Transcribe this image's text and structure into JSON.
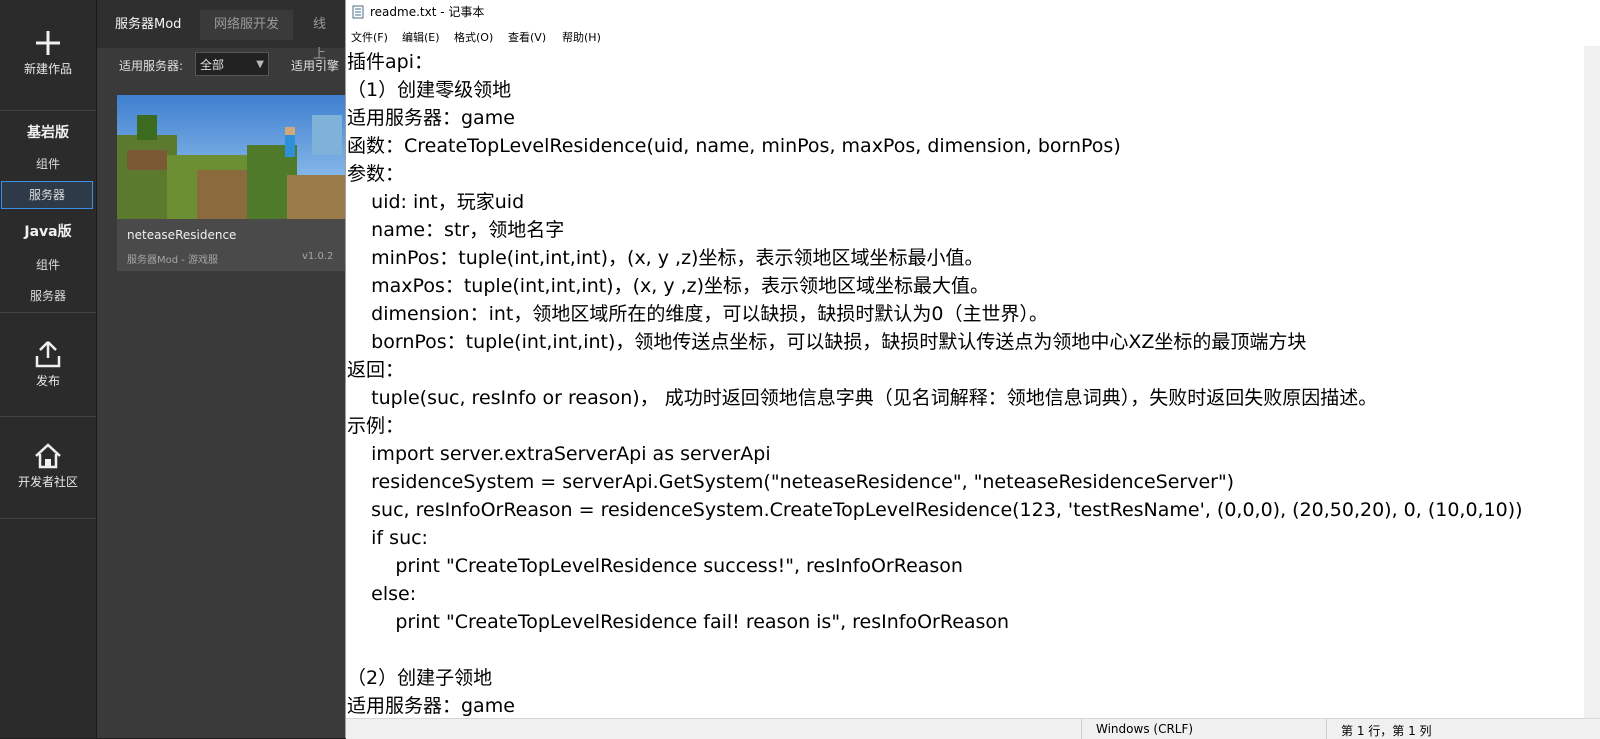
{
  "rail": {
    "new_work": "新建作品",
    "bedrock": "基岩版",
    "bedrock_component": "组件",
    "bedrock_server": "服务器",
    "java": "Java版",
    "java_component": "组件",
    "java_server": "服务器",
    "publish": "发布",
    "community": "开发者社区"
  },
  "tabs": [
    "服务器Mod",
    "网络服开发",
    "线上"
  ],
  "filter": {
    "server_label": "适用服务器:",
    "server_value": "全部",
    "engine_label": "适用引擎"
  },
  "card": {
    "title": "neteaseResidence",
    "meta": "服务器Mod - 游戏服",
    "version": "v1.0.2"
  },
  "notepad": {
    "title": "readme.txt - 记事本",
    "menu": [
      "文件(F)",
      "编辑(E)",
      "格式(O)",
      "查看(V)",
      "帮助(H)"
    ],
    "lines": [
      "插件api：",
      "（1）创建零级领地",
      "适用服务器：game",
      "函数：CreateTopLevelResidence(uid, name, minPos, maxPos, dimension, bornPos)",
      "参数：",
      "    uid: int，玩家uid",
      "    name：str，领地名字",
      "    minPos：tuple(int,int,int)，(x, y ,z)坐标，表示领地区域坐标最小值。",
      "    maxPos：tuple(int,int,int)，(x, y ,z)坐标，表示领地区域坐标最大值。",
      "    dimension：int，领地区域所在的维度，可以缺损，缺损时默认为0（主世界）。",
      "    bornPos：tuple(int,int,int)，领地传送点坐标，可以缺损，缺损时默认传送点为领地中心XZ坐标的最顶端方块",
      "返回：",
      "    tuple(suc, resInfo or reason)， 成功时返回领地信息字典（见名词解释：领地信息词典），失败时返回失败原因描述。",
      "示例：",
      "    import server.extraServerApi as serverApi",
      "    residenceSystem = serverApi.GetSystem(\"neteaseResidence\", \"neteaseResidenceServer\")",
      "    suc, resInfoOrReason = residenceSystem.CreateTopLevelResidence(123, 'testResName', (0,0,0), (20,50,20), 0, (10,0,10))",
      "    if suc:",
      "        print \"CreateTopLevelResidence success!\", resInfoOrReason",
      "    else:",
      "        print \"CreateTopLevelResidence fail! reason is\", resInfoOrReason",
      "",
      "（2）创建子领地",
      "适用服务器：game"
    ],
    "status_encoding": "Windows (CRLF)",
    "status_position": "第 1 行，第 1 列"
  },
  "colors": {
    "accent": "#3d8ee6",
    "rail_bg": "#2b2b2b",
    "panel_bg": "#3a3a3a"
  }
}
